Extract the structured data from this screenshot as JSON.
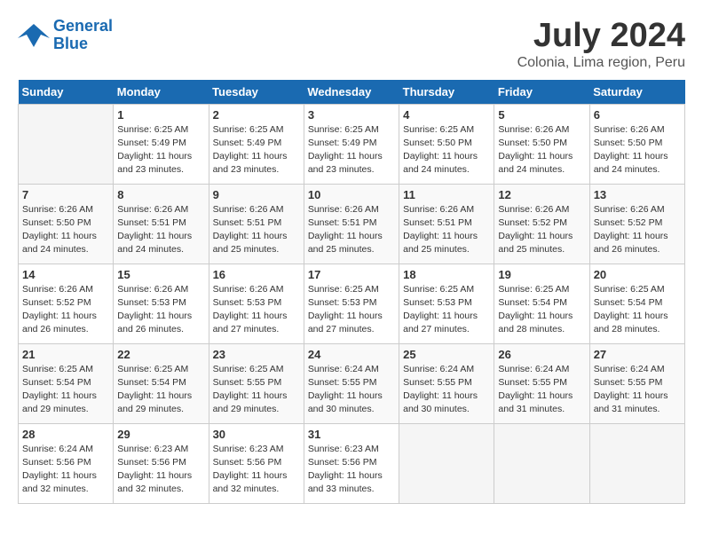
{
  "logo": {
    "line1": "General",
    "line2": "Blue"
  },
  "title": "July 2024",
  "subtitle": "Colonia, Lima region, Peru",
  "days_of_week": [
    "Sunday",
    "Monday",
    "Tuesday",
    "Wednesday",
    "Thursday",
    "Friday",
    "Saturday"
  ],
  "weeks": [
    [
      {
        "num": "",
        "info": ""
      },
      {
        "num": "1",
        "info": "Sunrise: 6:25 AM\nSunset: 5:49 PM\nDaylight: 11 hours\nand 23 minutes."
      },
      {
        "num": "2",
        "info": "Sunrise: 6:25 AM\nSunset: 5:49 PM\nDaylight: 11 hours\nand 23 minutes."
      },
      {
        "num": "3",
        "info": "Sunrise: 6:25 AM\nSunset: 5:49 PM\nDaylight: 11 hours\nand 23 minutes."
      },
      {
        "num": "4",
        "info": "Sunrise: 6:25 AM\nSunset: 5:50 PM\nDaylight: 11 hours\nand 24 minutes."
      },
      {
        "num": "5",
        "info": "Sunrise: 6:26 AM\nSunset: 5:50 PM\nDaylight: 11 hours\nand 24 minutes."
      },
      {
        "num": "6",
        "info": "Sunrise: 6:26 AM\nSunset: 5:50 PM\nDaylight: 11 hours\nand 24 minutes."
      }
    ],
    [
      {
        "num": "7",
        "info": "Sunrise: 6:26 AM\nSunset: 5:50 PM\nDaylight: 11 hours\nand 24 minutes."
      },
      {
        "num": "8",
        "info": "Sunrise: 6:26 AM\nSunset: 5:51 PM\nDaylight: 11 hours\nand 24 minutes."
      },
      {
        "num": "9",
        "info": "Sunrise: 6:26 AM\nSunset: 5:51 PM\nDaylight: 11 hours\nand 25 minutes."
      },
      {
        "num": "10",
        "info": "Sunrise: 6:26 AM\nSunset: 5:51 PM\nDaylight: 11 hours\nand 25 minutes."
      },
      {
        "num": "11",
        "info": "Sunrise: 6:26 AM\nSunset: 5:51 PM\nDaylight: 11 hours\nand 25 minutes."
      },
      {
        "num": "12",
        "info": "Sunrise: 6:26 AM\nSunset: 5:52 PM\nDaylight: 11 hours\nand 25 minutes."
      },
      {
        "num": "13",
        "info": "Sunrise: 6:26 AM\nSunset: 5:52 PM\nDaylight: 11 hours\nand 26 minutes."
      }
    ],
    [
      {
        "num": "14",
        "info": "Sunrise: 6:26 AM\nSunset: 5:52 PM\nDaylight: 11 hours\nand 26 minutes."
      },
      {
        "num": "15",
        "info": "Sunrise: 6:26 AM\nSunset: 5:53 PM\nDaylight: 11 hours\nand 26 minutes."
      },
      {
        "num": "16",
        "info": "Sunrise: 6:26 AM\nSunset: 5:53 PM\nDaylight: 11 hours\nand 27 minutes."
      },
      {
        "num": "17",
        "info": "Sunrise: 6:25 AM\nSunset: 5:53 PM\nDaylight: 11 hours\nand 27 minutes."
      },
      {
        "num": "18",
        "info": "Sunrise: 6:25 AM\nSunset: 5:53 PM\nDaylight: 11 hours\nand 27 minutes."
      },
      {
        "num": "19",
        "info": "Sunrise: 6:25 AM\nSunset: 5:54 PM\nDaylight: 11 hours\nand 28 minutes."
      },
      {
        "num": "20",
        "info": "Sunrise: 6:25 AM\nSunset: 5:54 PM\nDaylight: 11 hours\nand 28 minutes."
      }
    ],
    [
      {
        "num": "21",
        "info": "Sunrise: 6:25 AM\nSunset: 5:54 PM\nDaylight: 11 hours\nand 29 minutes."
      },
      {
        "num": "22",
        "info": "Sunrise: 6:25 AM\nSunset: 5:54 PM\nDaylight: 11 hours\nand 29 minutes."
      },
      {
        "num": "23",
        "info": "Sunrise: 6:25 AM\nSunset: 5:55 PM\nDaylight: 11 hours\nand 29 minutes."
      },
      {
        "num": "24",
        "info": "Sunrise: 6:24 AM\nSunset: 5:55 PM\nDaylight: 11 hours\nand 30 minutes."
      },
      {
        "num": "25",
        "info": "Sunrise: 6:24 AM\nSunset: 5:55 PM\nDaylight: 11 hours\nand 30 minutes."
      },
      {
        "num": "26",
        "info": "Sunrise: 6:24 AM\nSunset: 5:55 PM\nDaylight: 11 hours\nand 31 minutes."
      },
      {
        "num": "27",
        "info": "Sunrise: 6:24 AM\nSunset: 5:55 PM\nDaylight: 11 hours\nand 31 minutes."
      }
    ],
    [
      {
        "num": "28",
        "info": "Sunrise: 6:24 AM\nSunset: 5:56 PM\nDaylight: 11 hours\nand 32 minutes."
      },
      {
        "num": "29",
        "info": "Sunrise: 6:23 AM\nSunset: 5:56 PM\nDaylight: 11 hours\nand 32 minutes."
      },
      {
        "num": "30",
        "info": "Sunrise: 6:23 AM\nSunset: 5:56 PM\nDaylight: 11 hours\nand 32 minutes."
      },
      {
        "num": "31",
        "info": "Sunrise: 6:23 AM\nSunset: 5:56 PM\nDaylight: 11 hours\nand 33 minutes."
      },
      {
        "num": "",
        "info": ""
      },
      {
        "num": "",
        "info": ""
      },
      {
        "num": "",
        "info": ""
      }
    ]
  ]
}
